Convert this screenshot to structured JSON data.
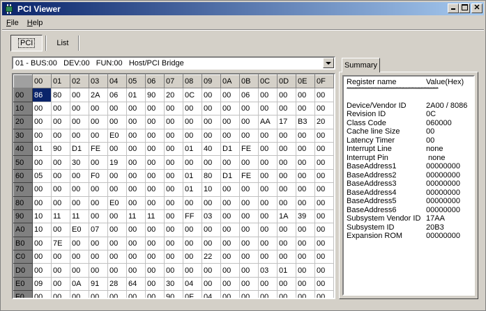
{
  "window": {
    "title": "PCI Viewer"
  },
  "menu": {
    "file": "File",
    "help": "Help"
  },
  "toolbar": {
    "pci": "PCI",
    "list": "List"
  },
  "device_select": {
    "value": "01 - BUS:00   DEV:00   FUN:00   Host/PCI Bridge"
  },
  "grid": {
    "columns": [
      "00",
      "01",
      "02",
      "03",
      "04",
      "05",
      "06",
      "07",
      "08",
      "09",
      "0A",
      "0B",
      "0C",
      "0D",
      "0E",
      "0F"
    ],
    "rows": [
      {
        "label": "00",
        "cells": [
          "86",
          "80",
          "00",
          "2A",
          "06",
          "01",
          "90",
          "20",
          "0C",
          "00",
          "00",
          "06",
          "00",
          "00",
          "00",
          "00"
        ]
      },
      {
        "label": "10",
        "cells": [
          "00",
          "00",
          "00",
          "00",
          "00",
          "00",
          "00",
          "00",
          "00",
          "00",
          "00",
          "00",
          "00",
          "00",
          "00",
          "00"
        ]
      },
      {
        "label": "20",
        "cells": [
          "00",
          "00",
          "00",
          "00",
          "00",
          "00",
          "00",
          "00",
          "00",
          "00",
          "00",
          "00",
          "AA",
          "17",
          "B3",
          "20"
        ]
      },
      {
        "label": "30",
        "cells": [
          "00",
          "00",
          "00",
          "00",
          "E0",
          "00",
          "00",
          "00",
          "00",
          "00",
          "00",
          "00",
          "00",
          "00",
          "00",
          "00"
        ]
      },
      {
        "label": "40",
        "cells": [
          "01",
          "90",
          "D1",
          "FE",
          "00",
          "00",
          "00",
          "00",
          "01",
          "40",
          "D1",
          "FE",
          "00",
          "00",
          "00",
          "00"
        ]
      },
      {
        "label": "50",
        "cells": [
          "00",
          "00",
          "30",
          "00",
          "19",
          "00",
          "00",
          "00",
          "00",
          "00",
          "00",
          "00",
          "00",
          "00",
          "00",
          "00"
        ]
      },
      {
        "label": "60",
        "cells": [
          "05",
          "00",
          "00",
          "F0",
          "00",
          "00",
          "00",
          "00",
          "01",
          "80",
          "D1",
          "FE",
          "00",
          "00",
          "00",
          "00"
        ]
      },
      {
        "label": "70",
        "cells": [
          "00",
          "00",
          "00",
          "00",
          "00",
          "00",
          "00",
          "00",
          "01",
          "10",
          "00",
          "00",
          "00",
          "00",
          "00",
          "00"
        ]
      },
      {
        "label": "80",
        "cells": [
          "00",
          "00",
          "00",
          "00",
          "E0",
          "00",
          "00",
          "00",
          "00",
          "00",
          "00",
          "00",
          "00",
          "00",
          "00",
          "00"
        ]
      },
      {
        "label": "90",
        "cells": [
          "10",
          "11",
          "11",
          "00",
          "00",
          "11",
          "11",
          "00",
          "FF",
          "03",
          "00",
          "00",
          "00",
          "1A",
          "39",
          "00"
        ]
      },
      {
        "label": "A0",
        "cells": [
          "10",
          "00",
          "E0",
          "07",
          "00",
          "00",
          "00",
          "00",
          "00",
          "00",
          "00",
          "00",
          "00",
          "00",
          "00",
          "00"
        ]
      },
      {
        "label": "B0",
        "cells": [
          "00",
          "7E",
          "00",
          "00",
          "00",
          "00",
          "00",
          "00",
          "00",
          "00",
          "00",
          "00",
          "00",
          "00",
          "00",
          "00"
        ]
      },
      {
        "label": "C0",
        "cells": [
          "00",
          "00",
          "00",
          "00",
          "00",
          "00",
          "00",
          "00",
          "00",
          "22",
          "00",
          "00",
          "00",
          "00",
          "00",
          "00"
        ]
      },
      {
        "label": "D0",
        "cells": [
          "00",
          "00",
          "00",
          "00",
          "00",
          "00",
          "00",
          "00",
          "00",
          "00",
          "00",
          "00",
          "03",
          "01",
          "00",
          "00"
        ]
      },
      {
        "label": "E0",
        "cells": [
          "09",
          "00",
          "0A",
          "91",
          "28",
          "64",
          "00",
          "30",
          "04",
          "00",
          "00",
          "00",
          "00",
          "00",
          "00",
          "00"
        ]
      },
      {
        "label": "F0",
        "cells": [
          "00",
          "00",
          "00",
          "00",
          "00",
          "00",
          "00",
          "90",
          "0F",
          "04",
          "00",
          "00",
          "00",
          "00",
          "00",
          "00"
        ]
      }
    ]
  },
  "summary": {
    "tab_label": "Summary",
    "header_name": "Register name",
    "header_value": "Value(Hex)",
    "stars": "**************************************************************",
    "items": [
      {
        "name": "Device/Vendor ID",
        "value": "2A00 / 8086"
      },
      {
        "name": "Revision ID",
        "value": "0C"
      },
      {
        "name": "Class Code",
        "value": "060000"
      },
      {
        "name": "Cache line Size",
        "value": "00"
      },
      {
        "name": "Latency Timer",
        "value": "00"
      },
      {
        "name": "Interrupt Line",
        "value": "none"
      },
      {
        "name": "Interrupt Pin",
        "value": " none"
      },
      {
        "name": "BaseAddress1",
        "value": "00000000"
      },
      {
        "name": "BaseAddress2",
        "value": "00000000"
      },
      {
        "name": "BaseAddress3",
        "value": "00000000"
      },
      {
        "name": "BaseAddress4",
        "value": "00000000"
      },
      {
        "name": "BaseAddress5",
        "value": "00000000"
      },
      {
        "name": "BaseAddress6",
        "value": "00000000"
      },
      {
        "name": "Subsystem Vendor ID",
        "value": "17AA"
      },
      {
        "name": "Subsystem ID",
        "value": "20B3"
      },
      {
        "name": "Expansion ROM",
        "value": "00000000"
      }
    ]
  }
}
